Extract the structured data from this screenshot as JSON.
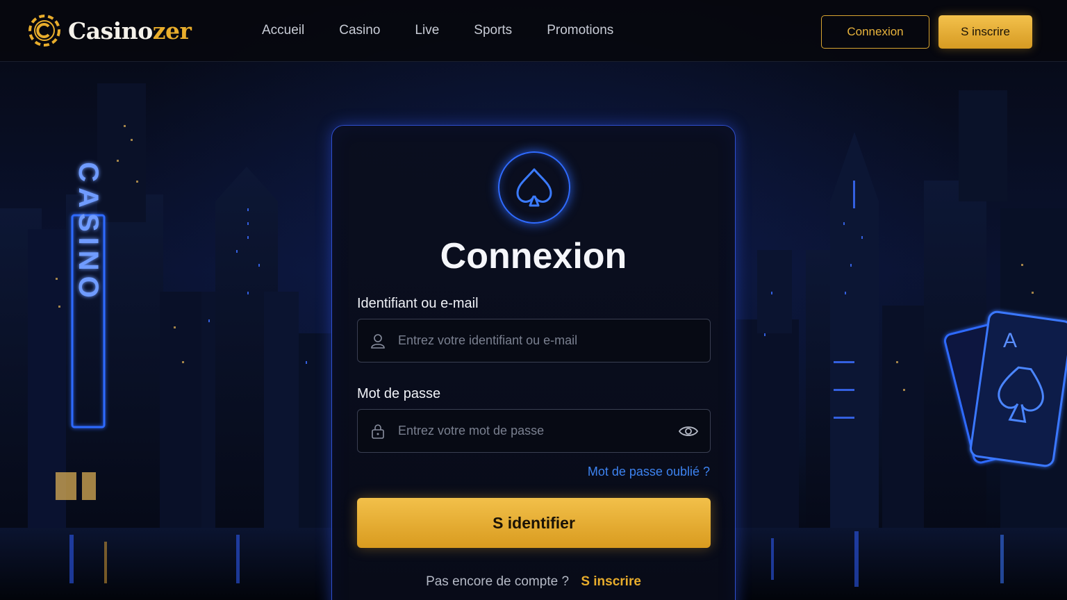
{
  "brand": {
    "name_main": "Casino",
    "name_accent": "zer",
    "accent_color": "#e8ad2c"
  },
  "nav": {
    "items": [
      "Accueil",
      "Casino",
      "Live",
      "Sports",
      "Promotions"
    ]
  },
  "header_actions": {
    "login_label": "Connexion",
    "signup_label": "S inscrire"
  },
  "background": {
    "neon_sign": "CASINO",
    "card_rank": "A"
  },
  "login": {
    "title": "Connexion",
    "username_label": "Identifiant ou e-mail",
    "username_placeholder": "Entrez votre identifiant ou e-mail",
    "password_label": "Mot de passe",
    "password_placeholder": "Entrez votre mot de passe",
    "forgot_label": "Mot de passe oublié ?",
    "submit_label": "S identifier",
    "no_account_text": "Pas encore de compte ?",
    "signup_link": "S inscrire"
  },
  "icons": [
    "spade-icon",
    "user-icon",
    "lock-icon",
    "eye-icon",
    "casino-chip-logo-icon"
  ]
}
